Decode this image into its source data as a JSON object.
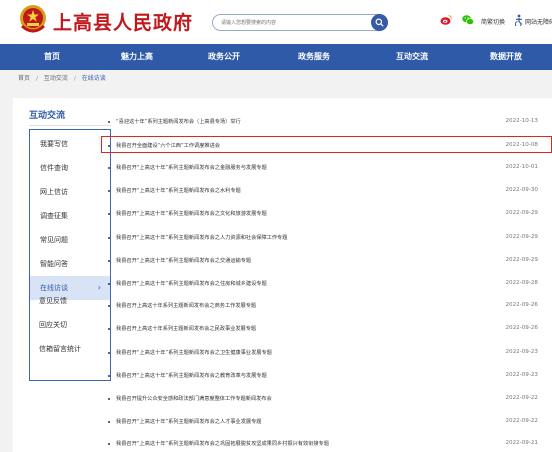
{
  "header": {
    "site_title": "上高县人民政府",
    "search_placeholder": "请输入您想要搜索的内容",
    "weibo_icon": "weibo-icon",
    "wechat_icon": "wechat-icon",
    "accessibility_label": "简繁切换",
    "elder_label": "网站无障碍"
  },
  "nav": {
    "items": [
      "首页",
      "魅力上高",
      "政务公开",
      "政务服务",
      "互动交流",
      "数据开放"
    ]
  },
  "breadcrumb": {
    "items": [
      "首页",
      "互动交流",
      "在线访谈"
    ]
  },
  "sidebar": {
    "title": "互动交流",
    "items": [
      "我要写信",
      "信件查询",
      "网上信访",
      "调查征集",
      "常见问题",
      "智能问答",
      "在线访谈"
    ],
    "extra": [
      "意见反馈",
      "回应关切",
      "信箱留言统计"
    ]
  },
  "list": {
    "items": [
      {
        "title": "“喜迎这十年”系列主题新闻发布会（上高县专场）举行",
        "date": "2022-10-13"
      },
      {
        "title": "我县召开全面建设“六个江西”工作调度推进会",
        "date": "2022-10-08"
      },
      {
        "title": "我县召开“上高这十年”系列主题新闻发布会之金融服务与发展专题",
        "date": "2022-10-01"
      },
      {
        "title": "我县召开“上高这十年”系列主题新闻发布会之水利专题",
        "date": "2022-09-30"
      },
      {
        "title": "我县召开“上高这十年”系列主题新闻发布会之文化和旅游发展专题",
        "date": "2022-09-29"
      },
      {
        "title": "我县召开“上高这十年”系列主题新闻发布会之人力资源和社会保障工作专题",
        "date": "2022-09-29"
      },
      {
        "title": "我县召开“上高这十年”系列主题新闻发布会之交通运输专题",
        "date": "2022-09-29"
      },
      {
        "title": "我县召开“上高这十年”系列主题新闻发布会之住房和城乡建设专题",
        "date": "2022-09-28"
      },
      {
        "title": "我县召开上高这十年系列主题新闻发布会之商务工作发展专题",
        "date": "2022-09-26"
      },
      {
        "title": "我县召开上高这十年系列主题新闻发布会之民政事业发展专题",
        "date": "2022-09-26"
      },
      {
        "title": "我县召开“上高这十年”系列主题新闻发布会之卫生健康事业发展专题",
        "date": "2022-09-23"
      },
      {
        "title": "我县召开“上高这十年”系列主题新闻发布会之教育改革与发展专题",
        "date": "2022-09-23"
      },
      {
        "title": "我县召开提升公众安全感和政法部门满意度整体工作专题新闻发布会",
        "date": "2022-09-22"
      },
      {
        "title": "我县召开“上高这十年”系列主题新闻发布会之人才事业发展专题",
        "date": "2022-09-22"
      },
      {
        "title": "我县召开“上高这十年”系列主题新闻发布会之巩固拓展脱贫攻坚成果同乡村振兴有效衔接专题",
        "date": "2022-09-21"
      }
    ]
  },
  "colors": {
    "brand_red": "#c0181b",
    "nav_blue": "#2f5aa8",
    "highlight_red": "#e02424"
  }
}
